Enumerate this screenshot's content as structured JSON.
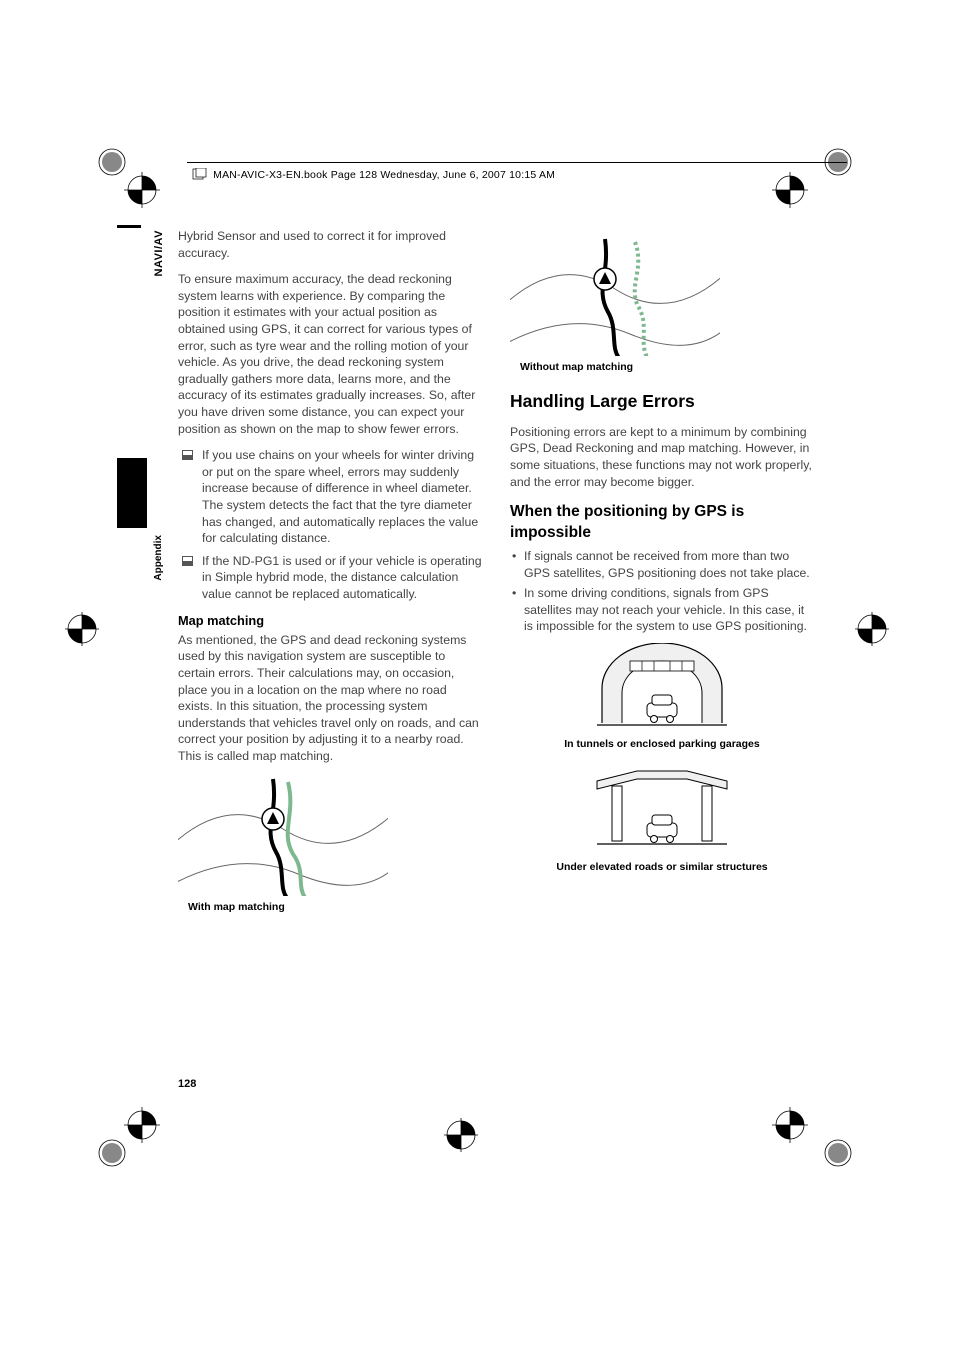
{
  "header": {
    "running_head": "MAN-AVIC-X3-EN.book  Page 128  Wednesday, June 6, 2007  10:15 AM"
  },
  "sidebar": {
    "naviav": "NAVI/AV",
    "appendix": "Appendix"
  },
  "left": {
    "p1": "Hybrid Sensor and used to correct it for improved accuracy.",
    "p2": "To ensure maximum accuracy, the dead reckoning system learns with experience. By comparing the position it estimates with your actual position as obtained using GPS, it can correct for various types of error, such as tyre wear and the rolling motion of your vehicle. As you drive, the dead reckoning system gradually gathers more data, learns more, and the accuracy of its estimates gradually increases. So, after you have driven some distance, you can expect your position as shown on the map to show fewer errors.",
    "li1": "If you use chains on your wheels for winter driving or put on the spare wheel, errors may suddenly increase because of difference in wheel diameter. The system detects the fact that the tyre diameter has changed, and automatically replaces the value for calculating distance.",
    "li2": "If the ND-PG1 is used or if your vehicle is operating in Simple hybrid mode, the distance calculation value cannot be replaced automatically.",
    "h_mapmatching": "Map matching",
    "p_mapmatching": "As mentioned, the GPS and dead reckoning systems used by this navigation system are susceptible to certain errors. Their calculations may, on occasion, place you in a location on the map where no road exists. In this situation, the processing system understands that vehicles travel only on roads, and can correct your position by adjusting it to a nearby road. This is called map matching.",
    "cap_with": "With map matching"
  },
  "right": {
    "cap_without": "Without map matching",
    "h_large": "Handling Large Errors",
    "p_large": "Positioning errors are kept to a minimum by combining GPS, Dead Reckoning and map matching. However, in some situations, these functions may not work properly, and the error may become bigger.",
    "h_gps": "When the positioning by GPS is impossible",
    "li_gps1": "If signals cannot be received from more than two GPS satellites, GPS positioning does not take place.",
    "li_gps2": "In some driving conditions, signals from GPS satellites may not reach your vehicle. In this case, it is impossible for the system to use GPS positioning.",
    "cap_tunnel": "In tunnels or enclosed parking garages",
    "cap_elev": "Under elevated roads or similar structures"
  },
  "page_number": "128"
}
